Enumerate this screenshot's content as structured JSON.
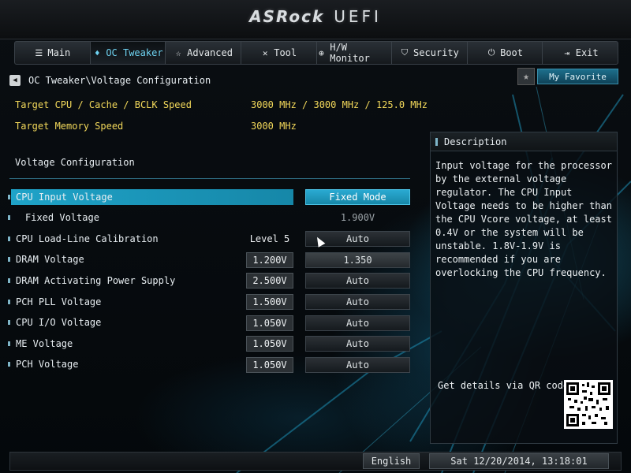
{
  "header": {
    "logo_brand": "ASRock",
    "logo_product": "UEFI"
  },
  "tabs": [
    {
      "label": "Main",
      "icon": "list-icon",
      "glyph": "☰"
    },
    {
      "label": "OC Tweaker",
      "icon": "flame-icon",
      "glyph": "♦"
    },
    {
      "label": "Advanced",
      "icon": "star-icon",
      "glyph": "☆"
    },
    {
      "label": "Tool",
      "icon": "tools-icon",
      "glyph": "✕"
    },
    {
      "label": "H/W Monitor",
      "icon": "monitor-icon",
      "glyph": "⊕"
    },
    {
      "label": "Security",
      "icon": "shield-icon",
      "glyph": "⛉"
    },
    {
      "label": "Boot",
      "icon": "power-icon",
      "glyph": "⏻"
    },
    {
      "label": "Exit",
      "icon": "exit-icon",
      "glyph": "⇥"
    }
  ],
  "active_tab": "OC Tweaker",
  "breadcrumb": {
    "path": "OC Tweaker\\Voltage Configuration",
    "back_glyph": "◀"
  },
  "favorite": {
    "label": "My Favorite",
    "glyph": "★"
  },
  "info": [
    {
      "label": "Target CPU / Cache / BCLK Speed",
      "value": "3000 MHz / 3000 MHz / 125.0 MHz"
    },
    {
      "label": "Target Memory Speed",
      "value": "3000 MHz"
    }
  ],
  "section_title": "Voltage Configuration",
  "settings": [
    {
      "label": "CPU Input Voltage",
      "current": "",
      "setting": "Fixed Mode"
    },
    {
      "label": "Fixed Voltage",
      "current": "",
      "setting": "1.900V"
    },
    {
      "label": "CPU Load-Line Calibration",
      "current": "Level 5",
      "setting": "Auto"
    },
    {
      "label": "DRAM Voltage",
      "current": "1.200V",
      "setting": "1.350"
    },
    {
      "label": "DRAM Activating Power Supply",
      "current": "2.500V",
      "setting": "Auto"
    },
    {
      "label": "PCH PLL Voltage",
      "current": "1.500V",
      "setting": "Auto"
    },
    {
      "label": "CPU I/O Voltage",
      "current": "1.050V",
      "setting": "Auto"
    },
    {
      "label": "ME Voltage",
      "current": "1.050V",
      "setting": "Auto"
    },
    {
      "label": "PCH Voltage",
      "current": "1.050V",
      "setting": "Auto"
    }
  ],
  "description": {
    "title": "Description",
    "text": "Input voltage for the processor by the external voltage regulator. The CPU Input Voltage needs to be higher than the CPU Vcore voltage, at least 0.4V or the system will be unstable. 1.8V-1.9V is recommended if you are overlocking the CPU frequency.",
    "qr_label": "Get details via QR code"
  },
  "footer": {
    "language": "English",
    "datetime": "Sat 12/20/2014, 13:18:01"
  },
  "colors": {
    "accent": "#1fa3c8",
    "info_text": "#f2d85a"
  }
}
